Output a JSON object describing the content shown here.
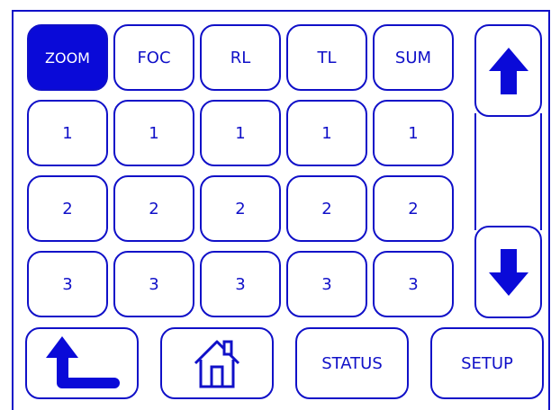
{
  "header_tabs": [
    {
      "label": "ZOOM",
      "active": true
    },
    {
      "label": "FOC",
      "active": false
    },
    {
      "label": "RL",
      "active": false
    },
    {
      "label": "TL",
      "active": false
    },
    {
      "label": "SUM",
      "active": false
    }
  ],
  "rows": [
    [
      "1",
      "1",
      "1",
      "1",
      "1"
    ],
    [
      "2",
      "2",
      "2",
      "2",
      "2"
    ],
    [
      "3",
      "3",
      "3",
      "3",
      "3"
    ]
  ],
  "bottom": {
    "back_icon": "back-arrow-icon",
    "home_icon": "home-icon",
    "status_label": "STATUS",
    "setup_label": "SETUP"
  },
  "scroll": {
    "up_icon": "arrow-up-icon",
    "down_icon": "arrow-down-icon"
  },
  "colors": {
    "accent": "#1010c8",
    "active_fill": "#0a0ad8",
    "background": "#ffffff"
  }
}
